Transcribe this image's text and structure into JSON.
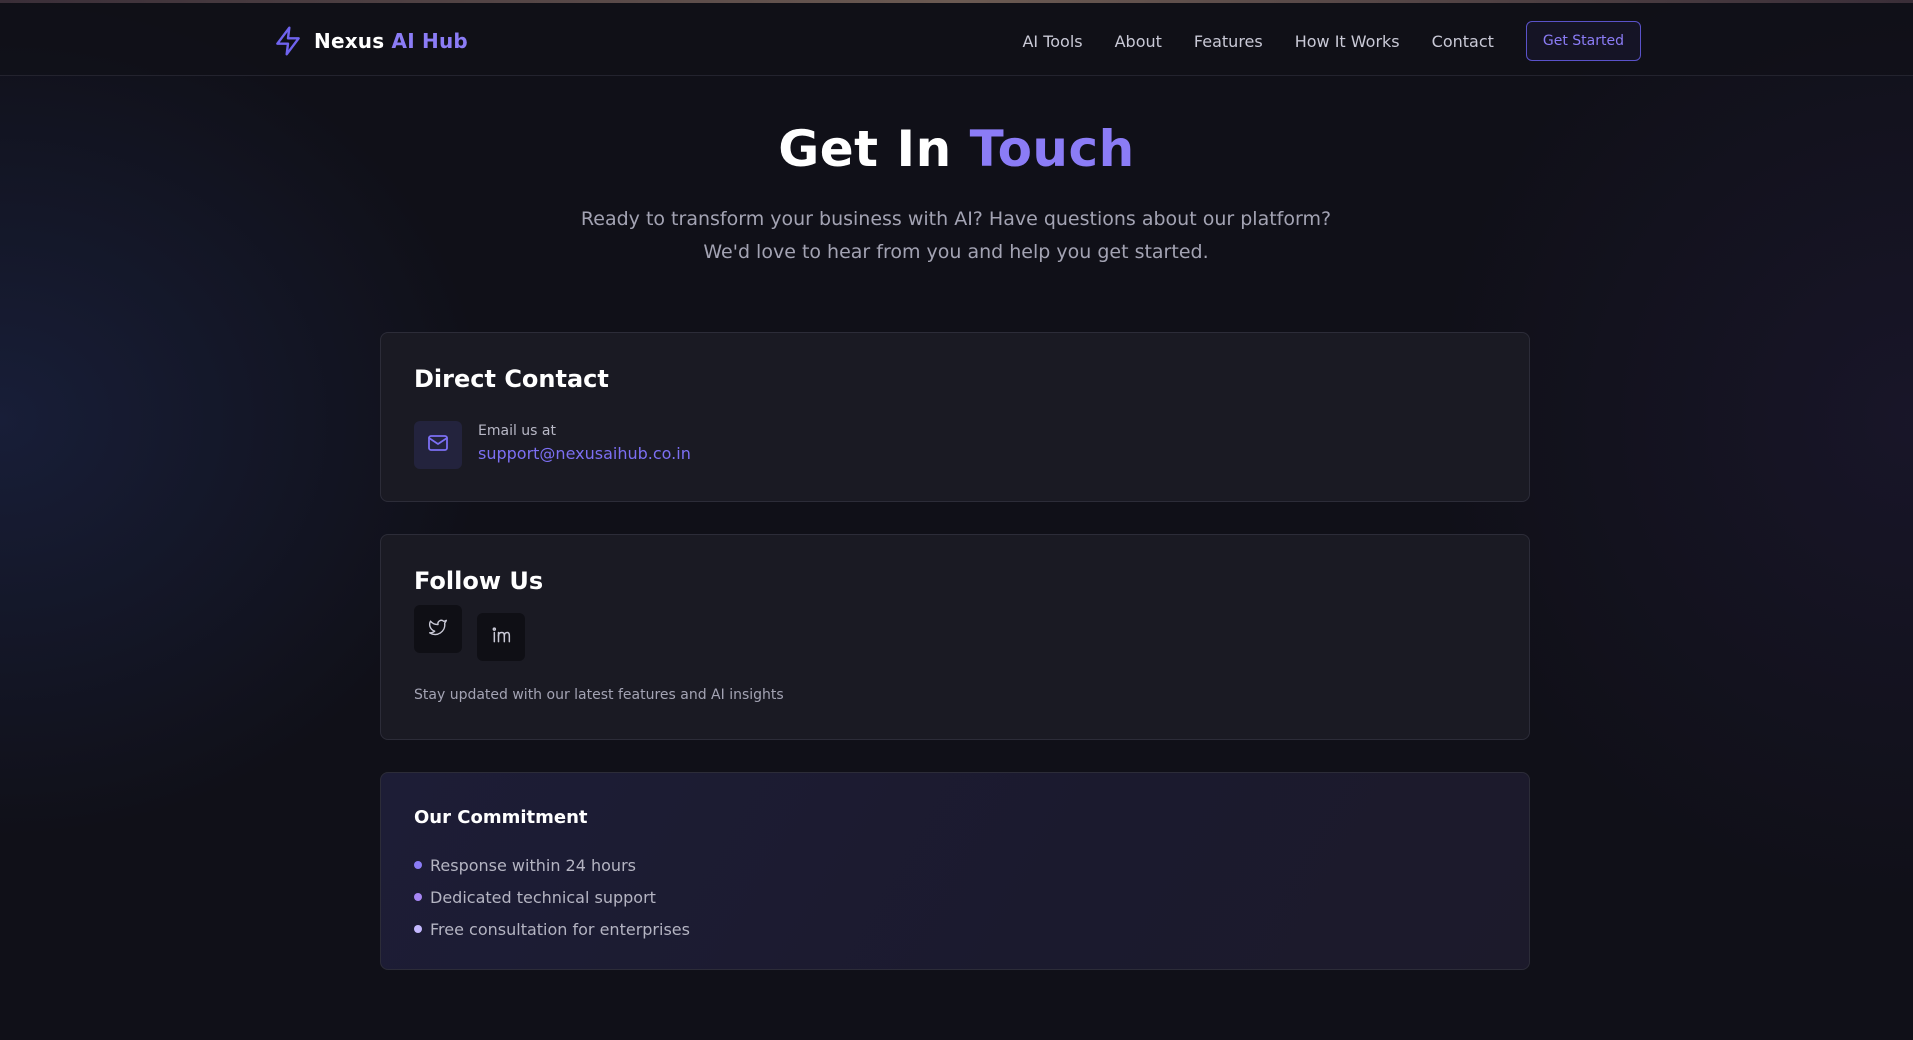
{
  "header": {
    "brand_name": "Nexus",
    "brand_accent": "AI Hub",
    "nav": [
      "AI Tools",
      "About",
      "Features",
      "How It Works",
      "Contact"
    ],
    "cta_label": "Get Started"
  },
  "hero": {
    "title_main": "Get In",
    "title_accent": "Touch",
    "subtitle": "Ready to transform your business with AI? Have questions about our platform? We'd love to hear from you and help you get started."
  },
  "direct_contact": {
    "heading": "Direct Contact",
    "email_label": "Email us at",
    "email": "support@nexusaihub.co.in",
    "icon": "mail-icon"
  },
  "follow": {
    "heading": "Follow Us",
    "socials": [
      {
        "name": "twitter",
        "icon": "twitter-icon"
      },
      {
        "name": "linkedin",
        "icon": "linkedin-icon"
      }
    ],
    "note": "Stay updated with our latest features and AI insights"
  },
  "commitment": {
    "heading": "Our Commitment",
    "items": [
      "Response within 24 hours",
      "Dedicated technical support",
      "Free consultation for enterprises"
    ]
  },
  "colors": {
    "accent": "#8b7cf6",
    "background": "#101018",
    "card": "#1a1a23"
  }
}
